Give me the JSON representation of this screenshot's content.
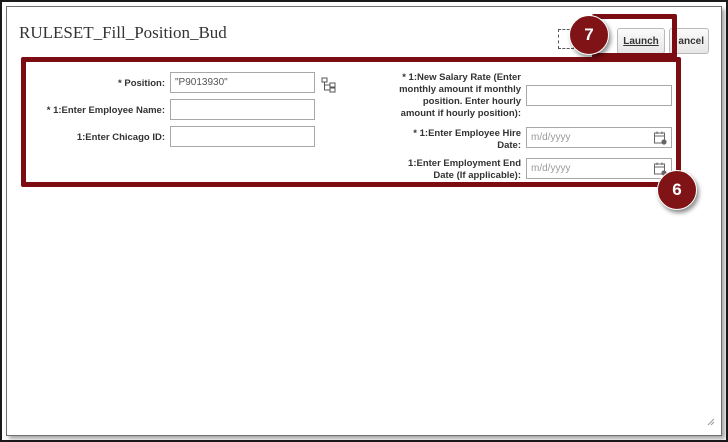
{
  "dialog": {
    "title": "RULESET_Fill_Position_Bud",
    "launch_label": "Launch",
    "cancel_label": "ancel"
  },
  "callouts": {
    "launch_step": "7",
    "form_step": "6"
  },
  "form": {
    "position_label": "* Position:",
    "position_value": "\"P9013930\"",
    "employee_name_label": "* 1:Enter Employee Name:",
    "employee_name_value": "",
    "chicago_id_label": "1:Enter Chicago ID:",
    "chicago_id_value": "",
    "salary_rate_label": "* 1:New Salary Rate (Enter monthly amount if monthly position. Enter hourly amount if hourly position):",
    "salary_rate_value": "",
    "hire_date_label": "* 1:Enter Employee Hire Date:",
    "hire_date_placeholder": "m/d/yyyy",
    "end_date_label": "1:Enter Employment End Date (If applicable):",
    "end_date_placeholder": "m/d/yyyy"
  },
  "colors": {
    "callout": "#7f1316",
    "highlight_border": "#7a0c12"
  },
  "icons": [
    "hierarchy-icon",
    "calendar-icon",
    "resize-grip-icon"
  ]
}
